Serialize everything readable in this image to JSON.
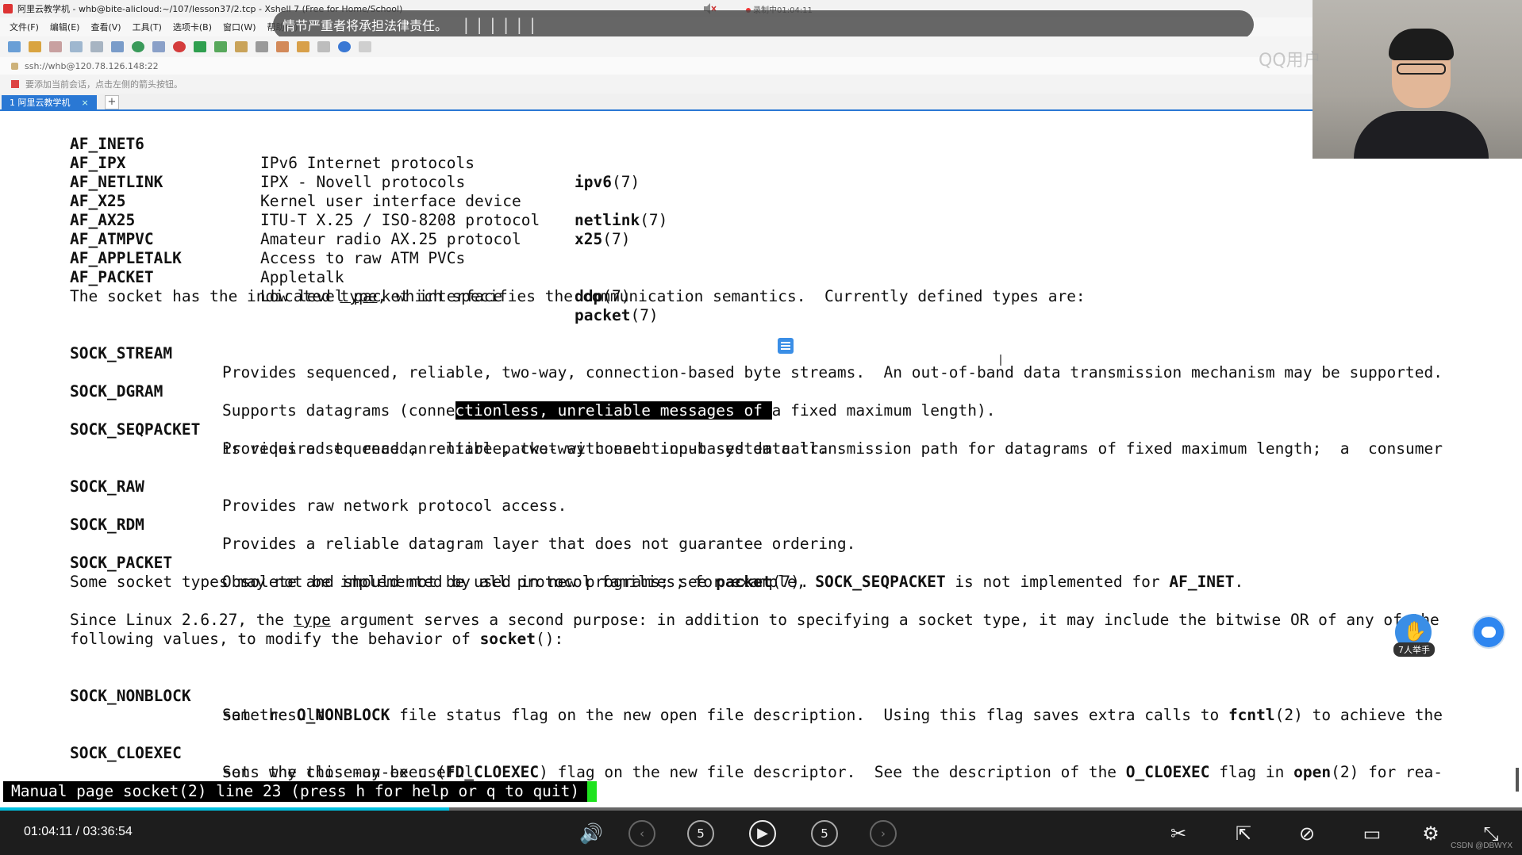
{
  "window": {
    "title": "阿里云教学机 - whb@bite-alicloud:~/107/lesson37/2.tcp - Xshell 7 (Free for Home/School)",
    "recording": "录制中01:04:11"
  },
  "notice": {
    "text": "情节严重者将承担法律责任。",
    "bars": "||||||"
  },
  "menu": [
    "文件(F)",
    "编辑(E)",
    "查看(V)",
    "工具(T)",
    "选项卡(B)",
    "窗口(W)",
    "帮助(H)"
  ],
  "address": "ssh://whb@120.78.126.148:22",
  "hint": "要添加当前会话，点击左侧的箭头按钮。",
  "tab": {
    "label": "1 阿里云教学机",
    "close": "×",
    "add": "+"
  },
  "manpage": {
    "families": [
      {
        "name": "AF_INET6",
        "desc": "IPv6 Internet protocols",
        "ref_name": "ipv6",
        "ref_sec": "(7)"
      },
      {
        "name": "AF_IPX",
        "desc": "IPX - Novell protocols",
        "ref_name": "",
        "ref_sec": ""
      },
      {
        "name": "AF_NETLINK",
        "desc": "Kernel user interface device",
        "ref_name": "netlink",
        "ref_sec": "(7)"
      },
      {
        "name": "AF_X25",
        "desc": "ITU-T X.25 / ISO-8208 protocol",
        "ref_name": "x25",
        "ref_sec": "(7)"
      },
      {
        "name": "AF_AX25",
        "desc": "Amateur radio AX.25 protocol",
        "ref_name": "",
        "ref_sec": ""
      },
      {
        "name": "AF_ATMPVC",
        "desc": "Access to raw ATM PVCs",
        "ref_name": "",
        "ref_sec": ""
      },
      {
        "name": "AF_APPLETALK",
        "desc": "Appletalk",
        "ref_name": "ddp",
        "ref_sec": "(7)"
      },
      {
        "name": "AF_PACKET",
        "desc": "Low level packet interface",
        "ref_name": "packet",
        "ref_sec": "(7)"
      }
    ],
    "type_intro_pre": "The socket has the indicated ",
    "type_word": "type",
    "type_intro_post": ", which specifies the communication semantics.  Currently defined types are:",
    "sock_stream": {
      "name": "SOCK_STREAM",
      "desc": "Provides sequenced, reliable, two-way, connection-based byte streams.  An out-of-band data transmission mechanism may be supported."
    },
    "sock_dgram": {
      "name": "SOCK_DGRAM",
      "desc_pre": "Supports datagrams (conne",
      "desc_sel": "ctionless, unreliable messages of ",
      "desc_post": "a fixed maximum length)."
    },
    "sock_seqpacket": {
      "name": "SOCK_SEQPACKET",
      "desc1": "Provides a sequenced, reliable, two-way connection-based data transmission path for datagrams of fixed maximum length;  a  consumer",
      "desc2": "is required to read an entire packet with each input system call."
    },
    "sock_raw": {
      "name": "SOCK_RAW",
      "desc": "Provides raw network protocol access."
    },
    "sock_rdm": {
      "name": "SOCK_RDM",
      "desc": "Provides a reliable datagram layer that does not guarantee ordering."
    },
    "sock_packet": {
      "name": "SOCK_PACKET",
      "desc_pre": "Obsolete and should not be used in new programs; see ",
      "ref": "packet",
      "desc_post": "(7)."
    },
    "impl_note": {
      "pre": "Some socket types may not be implemented by all protocol families; for example, ",
      "b1": "SOCK_SEQPACKET",
      "mid": " is not implemented for ",
      "b2": "AF_INET",
      "post": "."
    },
    "since": {
      "pre": "Since Linux 2.6.27, the ",
      "type_word": "type",
      "post": " argument serves a second purpose: in addition to specifying a socket type, it may include the bitwise OR of any of the",
      "line2_pre": "following values, to modify the behavior of ",
      "line2_bold": "socket",
      "line2_post": "():"
    },
    "nonblock": {
      "name": "SOCK_NONBLOCK",
      "pre": "Set the ",
      "flag": "O_NONBLOCK",
      "mid": " file status flag on the new open file description.  Using this flag saves extra calls to ",
      "fn": "fcntl",
      "post": "(2) to achieve the",
      "line2": "same result."
    },
    "cloexec": {
      "name": "SOCK_CLOEXEC",
      "pre": "Set  the close-on-exec (",
      "flag": "FD_CLOEXEC",
      "mid": ") flag on the new file descriptor.  See the description of the ",
      "flag2": "O_CLOEXEC",
      "mid2": " flag in ",
      "fn": "open",
      "post": "(2) for rea-",
      "line2": "sons why this may be useful."
    },
    "status": "Manual page socket(2) line 23 (press h for help or q to quit)"
  },
  "overlay": {
    "watermark": "QQ用户",
    "raise_hand": "7人举手"
  },
  "player": {
    "current": "01:04:11",
    "separator": "/",
    "total": "03:36:54",
    "progress": 0.295,
    "skip_back": "5",
    "skip_fwd": "5",
    "watermark": "CSDN @DBWYX"
  }
}
